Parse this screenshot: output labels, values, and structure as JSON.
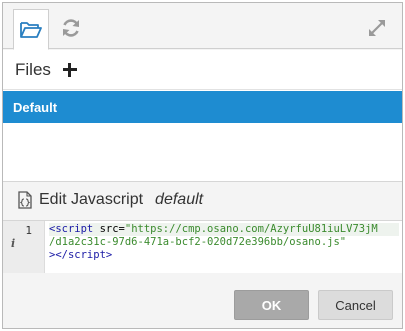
{
  "toolbar": {
    "icons": [
      "folder-open-icon",
      "refresh-icon",
      "expand-icon"
    ]
  },
  "files": {
    "title": "Files",
    "items": [
      {
        "label": "Default",
        "selected": true
      }
    ]
  },
  "editor": {
    "title": "Edit Javascript",
    "file_name": "default",
    "line_number": "1",
    "info_marker": "i",
    "code_line1_a": "<",
    "code_line1_tag": "script",
    "code_line1_attr": " src=",
    "code_line1_str": "\"https://cmp.osano.com/AzyrfuU81iuLV73jM",
    "code_line2_str": "/d1a2c31c-97d6-471a-bcf2-020d72e396bb/osano.js\"",
    "code_line3_a": "></",
    "code_line3_tag": "script",
    "code_line3_b": ">"
  },
  "footer": {
    "ok_label": "OK",
    "cancel_label": "Cancel"
  },
  "colors": {
    "selected": "#1e8cd1",
    "icon": "#2a7fc0"
  }
}
